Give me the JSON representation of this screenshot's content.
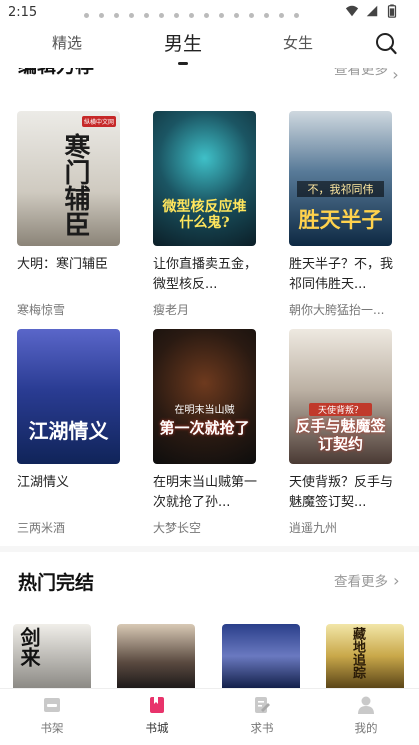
{
  "status": {
    "time": "2:15"
  },
  "tabs": [
    {
      "label": "精选"
    },
    {
      "label": "男生"
    },
    {
      "label": "女生"
    }
  ],
  "sections": {
    "editor": {
      "title": "编辑力荐",
      "more": "查看更多",
      "books": [
        {
          "title": "大明：寒门辅臣",
          "author": "寒梅惊雪",
          "cover_text": "寒门辅臣",
          "badge": "纵横中文网",
          "colors": [
            "#e8e6e1",
            "#b9b3a7"
          ]
        },
        {
          "title": "让你直播卖五金，微型核反...",
          "author": "瘦老月",
          "cover_text": "微型核反应堆什么鬼?",
          "colors": [
            "#0e2f3a",
            "#1e6b74"
          ]
        },
        {
          "title": "胜天半子？不，我祁同伟胜天...",
          "author": "朝你大胯猛抬一...",
          "cover_text": "胜天半子",
          "badge": "不，我祁同伟",
          "colors": [
            "#0d2a45",
            "#3e6c93"
          ]
        },
        {
          "title": "江湖情义",
          "author": "三两米酒",
          "cover_text": "江湖情义",
          "colors": [
            "#123a7a",
            "#6a4fb0"
          ]
        },
        {
          "title": "在明末当山贼第一次就抢了孙...",
          "author": "大梦长空",
          "cover_text": "第一次就抢了",
          "badge": "在明末当山贼",
          "colors": [
            "#1a1a1a",
            "#5b2016"
          ]
        },
        {
          "title": "天使背叛？反手与魅魔签订契...",
          "author": "逍遥九州",
          "cover_text": "反手与魅魔签订契约",
          "badge": "天使背叛？",
          "colors": [
            "#e6dfd5",
            "#3a2e2a"
          ]
        }
      ]
    },
    "hot": {
      "title": "热门完结",
      "more": "查看更多",
      "covers": [
        {
          "cover_text": "剑来",
          "colors": [
            "#e9e6e0",
            "#4a4a4a"
          ]
        },
        {
          "cover_text": "",
          "colors": [
            "#c9b9a6",
            "#2b2a2a"
          ]
        },
        {
          "cover_text": "",
          "colors": [
            "#16234a",
            "#6e7fbf"
          ]
        },
        {
          "cover_text": "藏地追踪",
          "colors": [
            "#e8d48a",
            "#4b3a12"
          ]
        }
      ]
    }
  },
  "bottom_nav": [
    {
      "label": "书架",
      "icon": "bookshelf-icon"
    },
    {
      "label": "书城",
      "icon": "bookstore-icon",
      "color": "#e8336b"
    },
    {
      "label": "求书",
      "icon": "request-book-icon"
    },
    {
      "label": "我的",
      "icon": "profile-icon"
    }
  ]
}
